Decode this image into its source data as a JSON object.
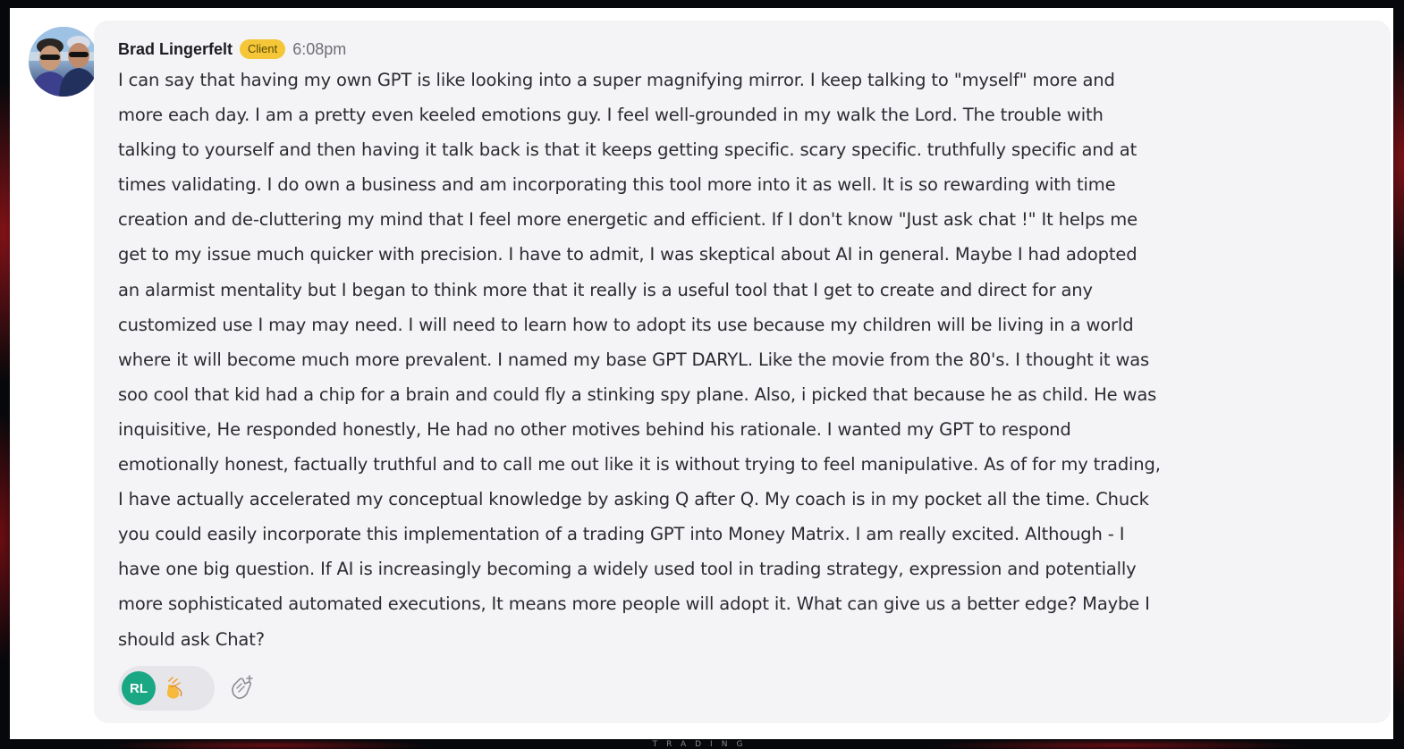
{
  "message": {
    "author": "Brad Lingerfelt",
    "role_badge": "Client",
    "time": "6:08pm",
    "lines": [
      "I can say that having my own GPT is like looking into a super magnifying mirror.  I keep talking to \"myself\" more and",
      "more each day.  I am a pretty even keeled emotions guy.  I feel well-grounded in my walk the Lord.  The trouble with",
      "talking to yourself and then having it talk back is that it keeps getting specific.  scary specific. truthfully specific and at",
      "times validating.  I do own a business and am incorporating this tool more into it as well.  It is so rewarding with time",
      "creation and de-cluttering my mind that I feel more energetic and efficient.  If I don't know \"Just ask chat !\"  It helps me",
      "get to my issue much quicker with precision.  I have to admit, I was skeptical about AI in general.  Maybe I had adopted",
      "an alarmist mentality but I began to think more that it really is a useful tool that I get to create and direct for any",
      "customized use I may may need.  I will need to learn how to adopt its use because my children will be living in a world",
      "where it will become much more prevalent.  I named my base GPT  DARYL.  Like the movie from the 80's. I thought it was",
      "soo cool that kid had a chip for a brain and could fly a stinking spy plane.  Also, i picked that because he as child.  He was",
      "inquisitive, He responded honestly, He had no other motives behind his rationale.  I wanted my GPT to respond",
      "emotionally honest, factually truthful and to call me out like it is without trying to feel manipulative.  As of for my trading,",
      "I have actually accelerated my conceptual knowledge by asking Q after Q.  My coach is in my pocket all the time. Chuck",
      "you could easily incorporate this implementation of a trading GPT into Money Matrix.  I am really excited.  Although - I",
      "have one big question.  If AI is increasingly becoming a widely used tool in trading strategy, expression and potentially",
      "more sophisticated automated executions, It means more people will adopt it.  What can give us a better edge?  Maybe I",
      "should ask Chat?"
    ]
  },
  "reactions": {
    "reactor_initials": "RL",
    "emoji_icon": "clapping-hands-icon",
    "add_reaction_icon": "add-reaction-icon"
  },
  "footer_brand": "TRADING",
  "colors": {
    "bubble_bg": "#f4f4f6",
    "badge_bg": "#f5c638",
    "reactor_avatar_bg": "#1aa784",
    "text": "#2c2b32",
    "time_text": "#6f6e76",
    "backdrop_accent": "#8c1418"
  }
}
